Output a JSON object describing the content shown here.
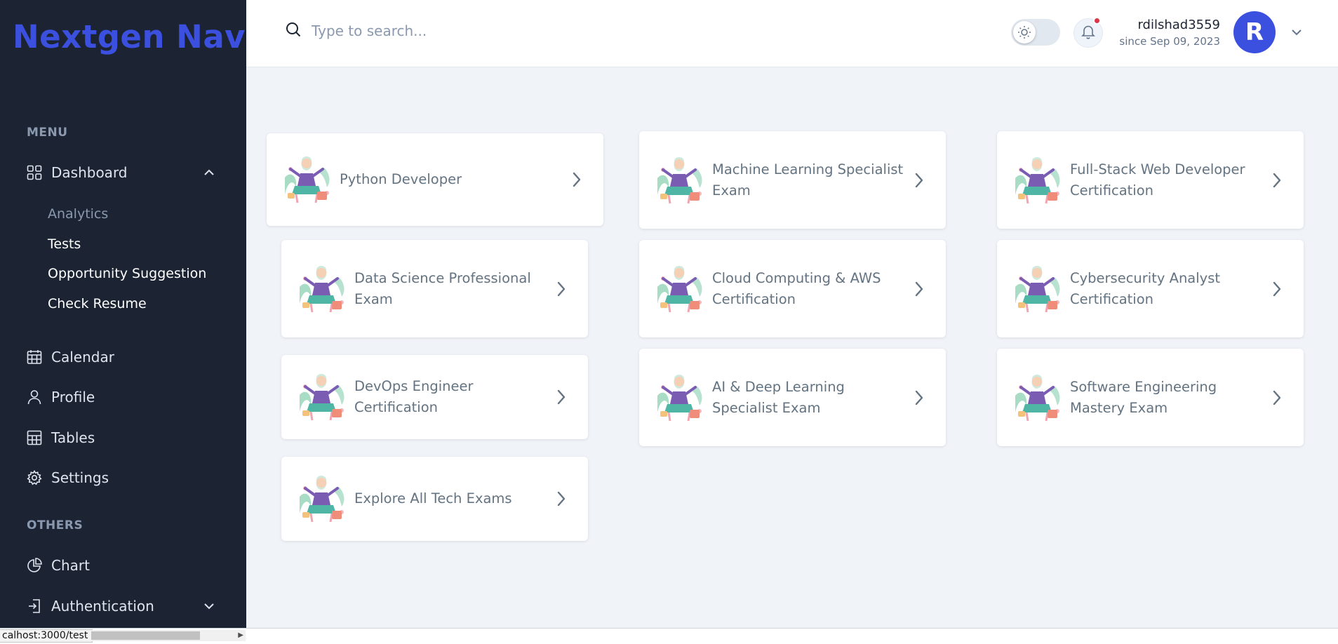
{
  "brand": "Nextgen Naviga",
  "sidebar": {
    "menu_title": "MENU",
    "others_title": "OTHERS",
    "dashboard": "Dashboard",
    "sub": [
      "Analytics",
      "Tests",
      "Opportunity Suggestion",
      "Check Resume"
    ],
    "calendar": "Calendar",
    "profile": "Profile",
    "tables": "Tables",
    "settings": "Settings",
    "chart": "Chart",
    "authentication": "Authentication"
  },
  "search": {
    "placeholder": "Type to search..."
  },
  "user": {
    "name": "rdilshad3559",
    "since": "since Sep 09, 2023",
    "initial": "R"
  },
  "cards": [
    "Python Developer",
    "Data Science Professional Exam",
    "DevOps Engineer Certification",
    "Explore All Tech Exams",
    "Machine Learning Specialist Exam",
    "Cloud Computing & AWS Certification",
    "AI & Deep Learning Specialist Exam",
    "Full-Stack Web Developer Certification",
    "Cybersecurity Analyst Certification",
    "Software Engineering Mastery Exam"
  ],
  "status_url": "calhost:3000/test",
  "colors": {
    "sidebar": "#1c2434",
    "accent": "#3c50e0",
    "page_bg": "#f0f4f9",
    "notification": "#dc3545"
  }
}
